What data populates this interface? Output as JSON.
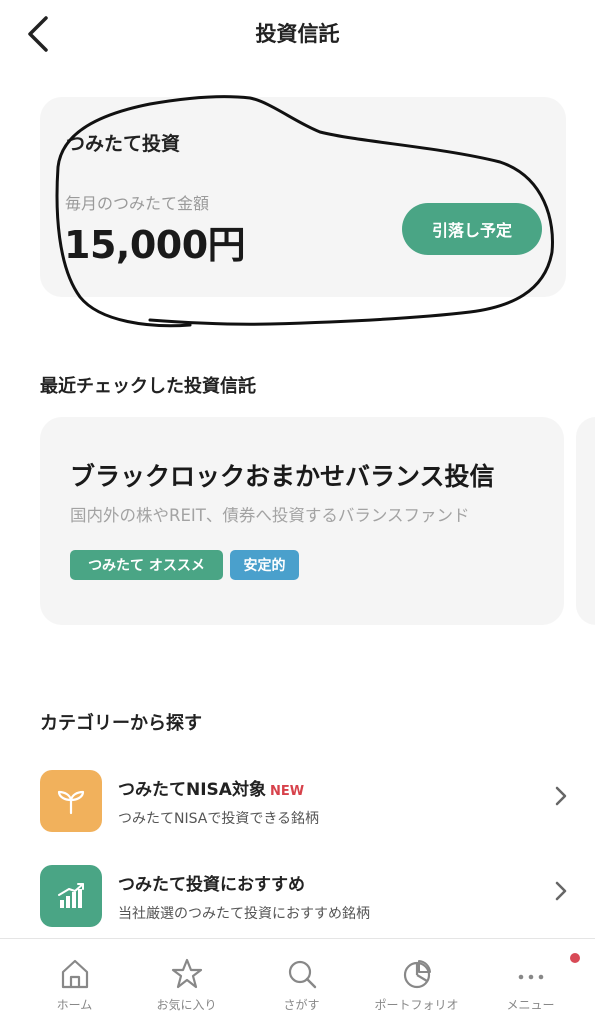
{
  "header": {
    "title": "投資信託"
  },
  "tsumitate": {
    "heading": "つみたて投資",
    "monthly_label": "毎月のつみたて金額",
    "monthly_amount": "15,000円",
    "debit_button": "引落し予定"
  },
  "recent": {
    "section_title": "最近チェックした投資信託",
    "fund": {
      "name": "ブラックロックおまかせバランス投信",
      "description": "国内外の株やREIT、債券へ投資するバランスファンド",
      "tags": [
        "つみたて オススメ",
        "安定的"
      ]
    }
  },
  "categories": {
    "section_title": "カテゴリーから探す",
    "items": [
      {
        "title": "つみたてNISA対象",
        "badge": "NEW",
        "description": "つみたてNISAで投資できる銘柄",
        "icon": "sprout-icon",
        "color": "#f1b15c"
      },
      {
        "title": "つみたて投資におすすめ",
        "badge": "",
        "description": "当社厳選のつみたて投資におすすめ銘柄",
        "icon": "bar-chart-icon",
        "color": "#4aa585"
      }
    ]
  },
  "bottom_nav": {
    "items": [
      {
        "label": "ホーム",
        "icon": "home-icon"
      },
      {
        "label": "お気に入り",
        "icon": "star-icon"
      },
      {
        "label": "さがす",
        "icon": "search-icon"
      },
      {
        "label": "ポートフォリオ",
        "icon": "pie-chart-icon"
      },
      {
        "label": "メニュー",
        "icon": "more-icon"
      }
    ]
  },
  "colors": {
    "accent_green": "#4aa585",
    "tag_blue": "#4aa0cc",
    "new_red": "#d7424b",
    "nisa_orange": "#f1b15c",
    "notification_dot": "#d84a56"
  }
}
